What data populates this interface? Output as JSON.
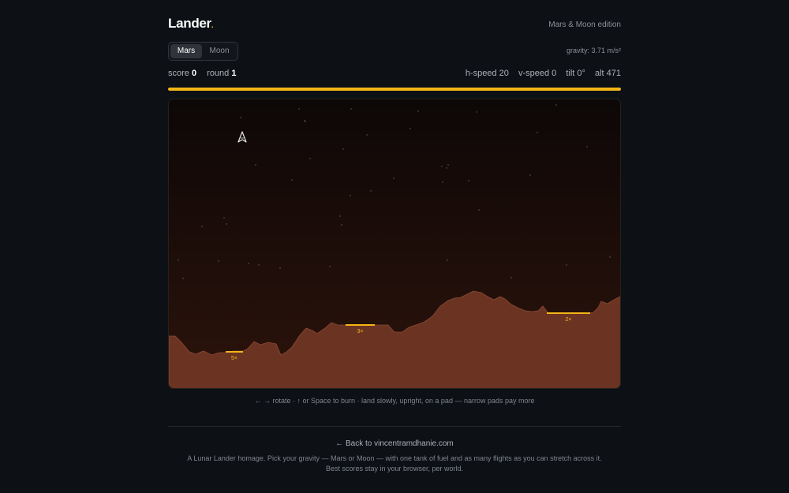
{
  "brand": {
    "name": "Lander",
    "dot": ".",
    "edition": "Mars & Moon edition"
  },
  "world_switch": {
    "options": [
      "Mars",
      "Moon"
    ],
    "selected": "Mars"
  },
  "gravity_text": "gravity: 3.71 m/s²",
  "stats": {
    "score_label": "score",
    "score": "0",
    "round_label": "round",
    "round": "1",
    "hspeed": "h-speed 20",
    "vspeed": "v-speed 0",
    "tilt": "tilt 0°",
    "alt": "alt 471"
  },
  "fuel": {
    "level": 1.0,
    "color": "#f5b617"
  },
  "game": {
    "colors": {
      "sky_top": "#0d0707",
      "sky_bottom": "#2c130b",
      "terrain": "#6b3422",
      "terrain_edge": "#8a4a33",
      "pad": "#f5b617",
      "lander": "#e8e8e8",
      "star": "#8a8a8a"
    },
    "pads": [
      {
        "multiplier": "5×"
      },
      {
        "multiplier": "3×"
      },
      {
        "multiplier": "2×"
      }
    ],
    "lander": {
      "tilt_deg": 0
    }
  },
  "controls_hint": "← → rotate · ↑ or Space to burn · land slowly, upright, on a pad — narrow pads pay more",
  "back_link": "← Back to vincentramdhanie.com",
  "about_line1": "A Lunar Lander homage. Pick your gravity — Mars or Moon — with one tank of fuel and as many flights as you can stretch across it.",
  "about_line2": "Best scores stay in your browser, per world."
}
